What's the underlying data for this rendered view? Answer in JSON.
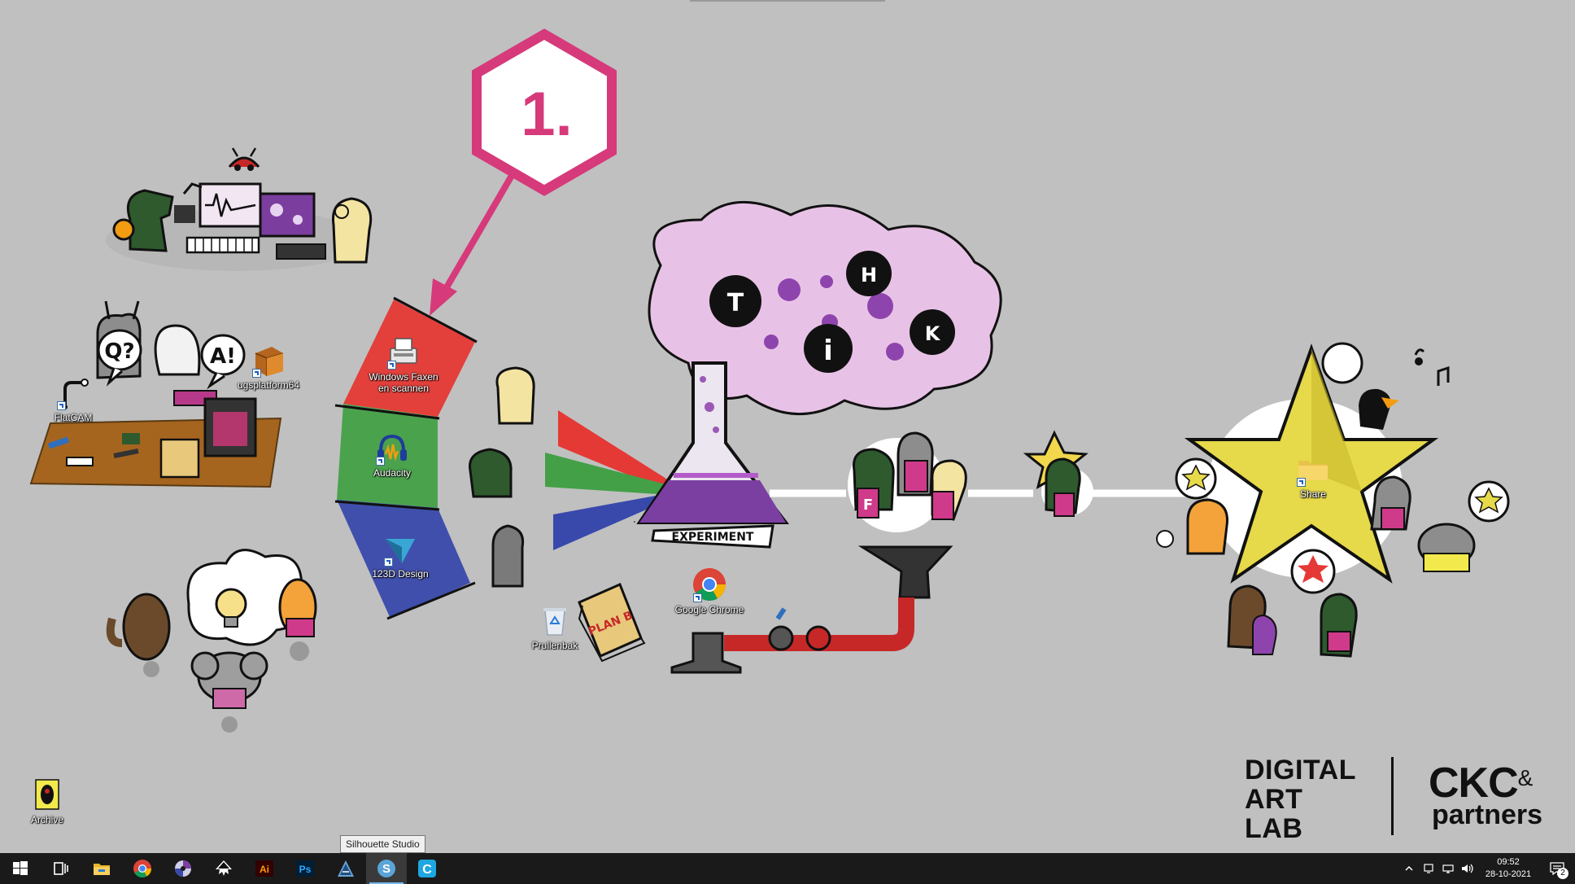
{
  "annotation": {
    "step_label": "1.",
    "color": "#d63a7a"
  },
  "wallpaper": {
    "flask_banner": "EXPERIMENT",
    "bubble_letters": [
      "T",
      "H",
      "i",
      "K"
    ],
    "speech_q": "Q?",
    "speech_a": "A!",
    "book_text": "PLAN B",
    "mascot_letter": "F",
    "spectrum_colors": {
      "red": "#e53935",
      "green": "#43a047",
      "blue": "#3949ab"
    },
    "brand": {
      "dal_line1": "DIGITAL",
      "dal_line2": "ART",
      "dal_line3": "LAB",
      "ckc": "CKC",
      "amp": "&",
      "partners": "partners"
    }
  },
  "desktop_icons": [
    {
      "label": "FlatCAM",
      "icon": "flatcam-icon"
    },
    {
      "label": "ugsplatform64",
      "icon": "ugs-cube-icon"
    },
    {
      "label": "Windows Faxen en scannen",
      "icon": "fax-icon"
    },
    {
      "label": "Audacity",
      "icon": "audacity-icon"
    },
    {
      "label": "123D Design",
      "icon": "123d-design-icon"
    },
    {
      "label": "Prullenbak",
      "icon": "recycle-bin-icon"
    },
    {
      "label": "Google Chrome",
      "icon": "chrome-icon"
    },
    {
      "label": "Share",
      "icon": "folder-icon"
    },
    {
      "label": "Archive",
      "icon": "archive-icon"
    }
  ],
  "tooltip": "Silhouette Studio",
  "taskbar": {
    "items": [
      {
        "name": "start",
        "icon": "windows-logo-icon"
      },
      {
        "name": "task-view",
        "icon": "task-view-icon"
      },
      {
        "name": "file-explorer",
        "icon": "folder-icon"
      },
      {
        "name": "chrome",
        "icon": "chrome-icon"
      },
      {
        "name": "app-disc",
        "icon": "disc-icon"
      },
      {
        "name": "inkscape",
        "icon": "inkscape-icon"
      },
      {
        "name": "illustrator",
        "icon": "illustrator-icon",
        "text": "Ai"
      },
      {
        "name": "photoshop",
        "icon": "photoshop-icon",
        "text": "Ps"
      },
      {
        "name": "autodesk",
        "icon": "autodesk-icon"
      },
      {
        "name": "silhouette-studio",
        "icon": "silhouette-icon",
        "text": "S"
      },
      {
        "name": "cura",
        "icon": "cura-icon",
        "text": "C"
      }
    ],
    "clock_time": "09:52",
    "clock_date": "28-10-2021",
    "notification_count": "2"
  }
}
